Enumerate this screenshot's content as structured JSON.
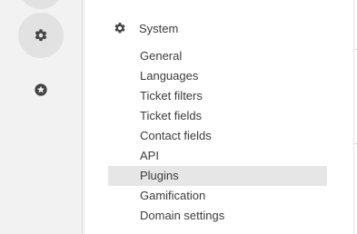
{
  "rail": {
    "buttons": [
      {
        "icon": "partial-icon"
      },
      {
        "icon": "gear-icon"
      },
      {
        "icon": "star-badge-icon"
      }
    ]
  },
  "settings": {
    "section_icon": "gear-icon",
    "section_title": "System",
    "items": [
      {
        "label": "General"
      },
      {
        "label": "Languages"
      },
      {
        "label": "Ticket filters"
      },
      {
        "label": "Ticket fields"
      },
      {
        "label": "Contact fields"
      },
      {
        "label": "API"
      },
      {
        "label": "Plugins"
      },
      {
        "label": "Gamification"
      },
      {
        "label": "Domain settings"
      }
    ],
    "selected_item": "Plugins"
  },
  "colors": {
    "rail_bg": "#f2f2f2",
    "rail_button_active": "#e2e2e2",
    "icon_dark": "#444444",
    "selected_row_bg": "#e6e6e6"
  }
}
